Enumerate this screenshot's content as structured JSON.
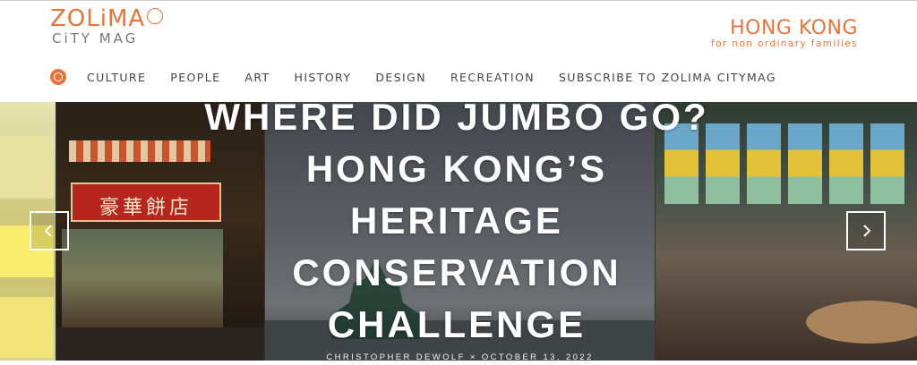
{
  "header": {
    "logo": {
      "main": "ZOLiMA",
      "sub": "CiTY MAG"
    },
    "tagline": {
      "title": "HONG KONG",
      "subtitle": "for non ordinary families"
    }
  },
  "nav": {
    "items": [
      {
        "label": "CULTURE"
      },
      {
        "label": "PEOPLE"
      },
      {
        "label": "ART"
      },
      {
        "label": "HISTORY"
      },
      {
        "label": "DESIGN"
      },
      {
        "label": "RECREATION"
      },
      {
        "label": "SUBSCRIBE TO ZOLIMA CITYMAG"
      }
    ]
  },
  "hero": {
    "headline": [
      "WHERE DID JUMBO GO?",
      "HONG KONG’S",
      "HERITAGE",
      "CONSERVATION",
      "CHALLENGE"
    ],
    "byline": "CHRISTOPHER DEWOLF × OCTOBER 13, 2022",
    "sign_text": "豪華餅店"
  },
  "colors": {
    "accent": "#e8743b",
    "nav_text": "#444444"
  },
  "icons": {
    "nav_logo": "zolima-logo-icon",
    "prev": "chevron-left-icon",
    "next": "chevron-right-icon"
  }
}
